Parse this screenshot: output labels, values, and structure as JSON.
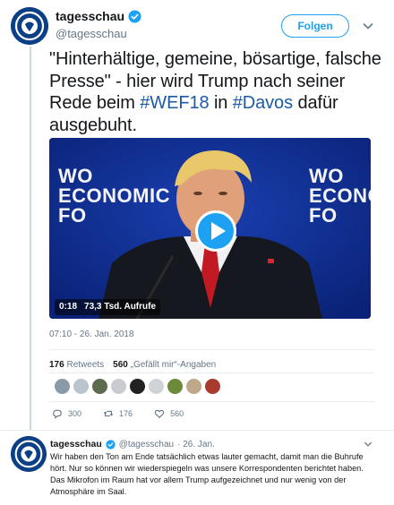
{
  "account": {
    "name": "tagesschau",
    "handle": "@tagesschau",
    "follow_label": "Folgen"
  },
  "tweet": {
    "text_parts": [
      {
        "text": "\"Hinterhältige, gemeine, bösartige, falsche Presse\" - hier wird Trump nach seiner Rede beim ",
        "type": "plain"
      },
      {
        "text": "#WEF18",
        "type": "hashtag"
      },
      {
        "text": " in ",
        "type": "plain"
      },
      {
        "text": "#Davos",
        "type": "hashtag"
      },
      {
        "text": " dafür ausgebuht.",
        "type": "plain"
      }
    ],
    "video": {
      "duration": "0:18",
      "views": "73,3 Tsd. Aufrufe",
      "overlay_left": [
        "WO",
        "ECONOMIC",
        "FO"
      ],
      "overlay_right": [
        "WO",
        "ECONO",
        "FO"
      ]
    },
    "timestamp": "07:10 - 26. Jan. 2018",
    "stats": {
      "retweets_count": "176",
      "retweets_label": "Retweets",
      "likes_count": "560",
      "likes_label": "„Gefällt mir“-Angaben"
    },
    "liker_colors": [
      "#8a9aa8",
      "#b9c4cc",
      "#5d6b4e",
      "#c8ccd0",
      "#222222",
      "#d0d4d8",
      "#6d8a3a",
      "#bfa88a",
      "#a83a2e"
    ],
    "actions": {
      "replies": "300",
      "retweets": "176",
      "likes": "560"
    }
  },
  "reply": {
    "name": "tagesschau",
    "handle": "@tagesschau",
    "date": "· 26. Jan.",
    "text": "Wir haben den Ton am Ende tatsächlich etwas lauter gemacht, damit man die Buhrufe hört. Nur so können wir wiederspiegeln was unsere Korrespondenten berichtet haben. Das Mikrofon im Raum hat vor allem Trump aufgezeichnet und nur wenig von der Atmosphäre im Saal."
  },
  "colors": {
    "accent": "#1da1f2",
    "hashtag": "#1b5aa8",
    "muted": "#657786",
    "avatar_bg": "#0b3f86",
    "video_bg": "#0d2a8a"
  }
}
